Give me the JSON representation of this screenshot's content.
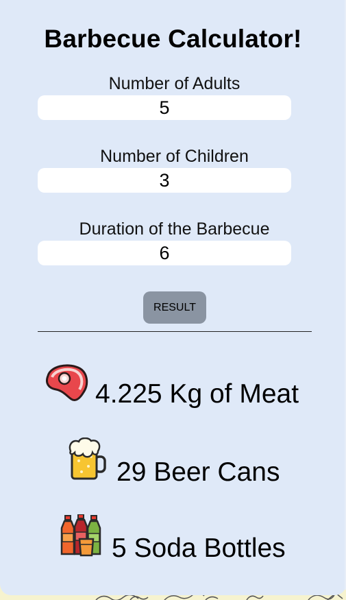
{
  "title": "Barbecue Calculator!",
  "fields": [
    {
      "label": "Number of Adults",
      "value": "5"
    },
    {
      "label": "Number of Children",
      "value": "3"
    },
    {
      "label": "Duration of the Barbecue",
      "value": "6"
    }
  ],
  "button": {
    "label": "RESULT"
  },
  "results": {
    "meat": "4.225 Kg of Meat",
    "beer": "29 Beer Cans",
    "soda": "5 Soda Bottles"
  },
  "icons": {
    "meat": "steak-icon",
    "beer": "beer-mug-icon",
    "soda": "soda-bottles-icon"
  },
  "colors": {
    "card_background": "#dfe9f8",
    "page_background": "#f6f3cf",
    "button_background": "#8a94a2",
    "input_background": "#ffffff"
  }
}
